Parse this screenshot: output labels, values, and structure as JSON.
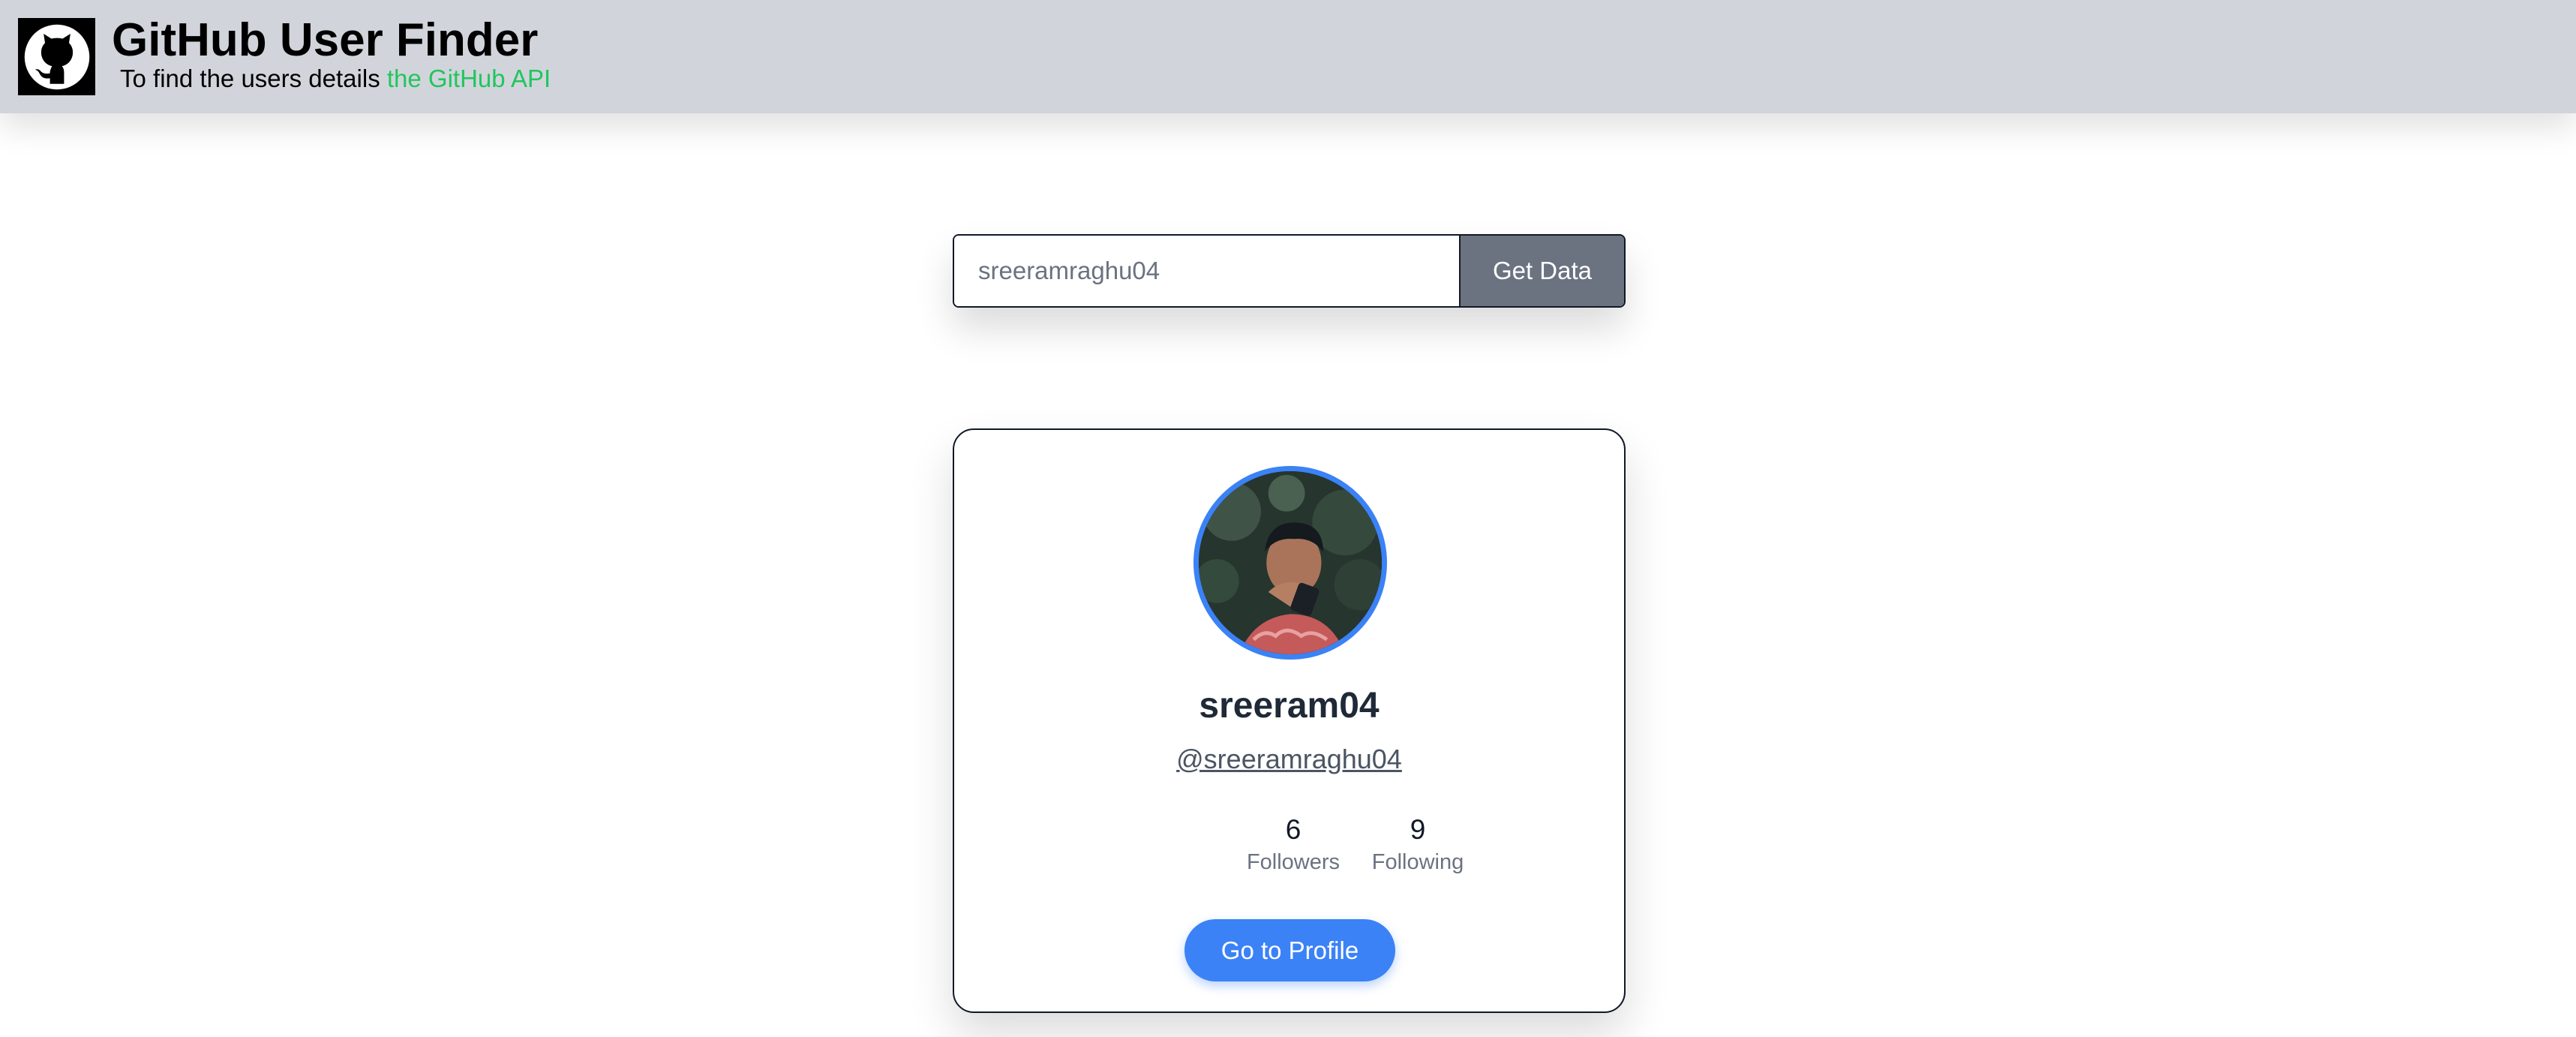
{
  "header": {
    "title": "GitHub User Finder",
    "subtitle_text": "To find the users details ",
    "subtitle_link": "the GitHub API",
    "logo_icon": "github-icon",
    "background_color": "#d1d5db",
    "link_color": "#22c55e"
  },
  "search": {
    "value": "sreeramraghu04",
    "button_label": "Get Data",
    "button_color": "#6b7280"
  },
  "profile": {
    "avatar_icon": "user-avatar-photo",
    "name": "sreeram04",
    "handle": "@sreeramraghu04",
    "followers_count": "6",
    "followers_label": "Followers",
    "following_count": "9",
    "following_label": "Following",
    "button_label": "Go to Profile",
    "accent_color": "#3b82f6"
  }
}
